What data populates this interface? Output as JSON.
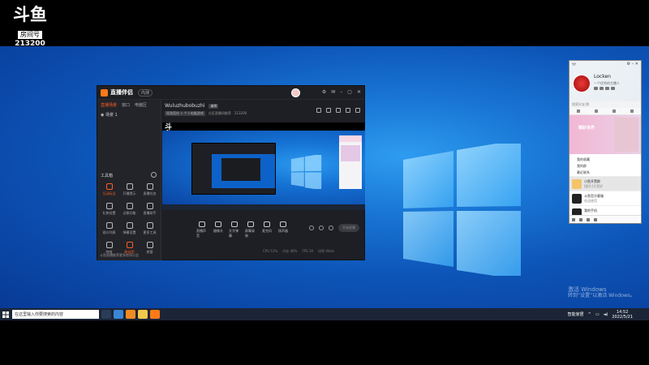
{
  "overlay": {
    "logo_text": "斗鱼",
    "room_label": "房间号",
    "room_number": "213200"
  },
  "app": {
    "title": "直播伴侣",
    "version_badge": "内测",
    "left_tabs": [
      "直播场景",
      "窗口",
      "电脑区"
    ],
    "scene_label": "场景 1",
    "tools_title": "工具箱",
    "tools": [
      {
        "label": "互动玩法",
        "hot": true
      },
      {
        "label": "开播提示",
        "hot": false
      },
      {
        "label": "直播任务",
        "hot": false
      },
      {
        "label": "礼物设置",
        "hot": false
      },
      {
        "label": "点歌功能",
        "hot": false
      },
      {
        "label": "直播助手",
        "hot": false
      },
      {
        "label": "观众列表",
        "hot": false
      },
      {
        "label": "弹幕设置",
        "hot": false
      },
      {
        "label": "更多工具",
        "hot": false
      },
      {
        "label": "特效",
        "hot": false
      },
      {
        "label": "粉丝团",
        "hot": true
      },
      {
        "label": "房管",
        "hot": false
      }
    ],
    "left_footer": "斗鱼直播推荐更多房间公告",
    "room_title": "Wuluzhubobuzhi",
    "room_tag": "编辑",
    "room_sub": [
      "网游竞技 > 个人电脑游戏",
      "分区直播间推荐",
      "213200"
    ],
    "controls": [
      "直播声音",
      "摄像头",
      "文字弹幕",
      "屏幕录制",
      "麦克风",
      "扬声器"
    ],
    "go_live_label": "开始直播",
    "status_items": [
      "CPU 12%",
      "内存 48%",
      "FPS 30",
      "码率 0kb/s"
    ]
  },
  "chat": {
    "window_title": "YY",
    "user_name": "Locken",
    "signature": "一个优秀的主播人",
    "search_placeholder": "搜索好友/群",
    "banner_text": "精彩世界",
    "menu_items": [
      "我的收藏",
      "我的群",
      "最近联系"
    ],
    "list": [
      {
        "title": "小鱼开黑群",
        "sub": "[图片]大家好",
        "dark": false,
        "selected": true
      },
      {
        "title": "斗鱼官方客服",
        "sub": "欢迎使用",
        "dark": true,
        "selected": false
      },
      {
        "title": "我的手机",
        "sub": "",
        "dark": true,
        "selected": false
      }
    ]
  },
  "taskbar": {
    "search_placeholder": "在这里输入你要搜索的内容",
    "tray_text": "智能家居",
    "time": "14:52",
    "date": "2022/5/21"
  },
  "desktop": {
    "activate_line1": "激活 Windows",
    "activate_line2": "转到“设置”以激活 Windows。"
  },
  "colors": {
    "accent": "#ff5d23",
    "desktop_blue": "#1a78d6",
    "taskbar": "#1b2536"
  }
}
